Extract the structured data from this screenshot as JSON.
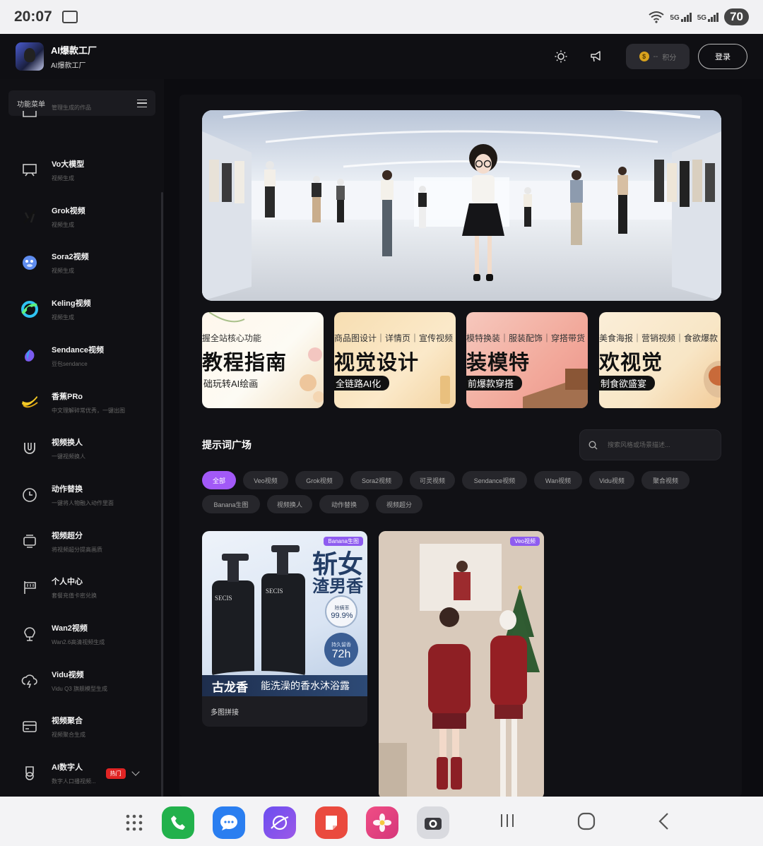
{
  "status": {
    "time": "20:07",
    "sig1": "5G",
    "sig2": "5G",
    "battery": "70"
  },
  "header": {
    "brand_title": "AI爆款工厂",
    "brand_sub": "AI爆款工厂",
    "points_value": "--",
    "points_unit": "积分",
    "login_label": "登录"
  },
  "sidebar": {
    "menu_title": "功能菜单",
    "items": [
      {
        "name": "",
        "desc": "管理生成的作品",
        "icon": "folder-icon"
      },
      {
        "name": "Vo大模型",
        "desc": "视频生成",
        "icon": "monitor-icon"
      },
      {
        "name": "Grok视频",
        "desc": "视频生成",
        "icon": "grok-logo-icon"
      },
      {
        "name": "Sora2视频",
        "desc": "视频生成",
        "icon": "sora-logo-icon"
      },
      {
        "name": "Keling视频",
        "desc": "视频生成",
        "icon": "keling-logo-icon"
      },
      {
        "name": "Sendance视频",
        "desc": "豆包sendance",
        "icon": "sendance-logo-icon"
      },
      {
        "name": "香蕉PRo",
        "desc": "中文理解碎常优秀，一键出图",
        "icon": "banana-icon"
      },
      {
        "name": "视频换人",
        "desc": "一键视频换人",
        "icon": "magnet-icon"
      },
      {
        "name": "动作替换",
        "desc": "一键将人物融入动作里面",
        "icon": "clock-icon"
      },
      {
        "name": "视频超分",
        "desc": "将视频超分提高画质",
        "icon": "upscale-icon"
      },
      {
        "name": "个人中心",
        "desc": "套餐充值卡密兑换",
        "icon": "flag-icon"
      },
      {
        "name": "Wan2视频",
        "desc": "Wan2.6高清视频生成",
        "icon": "wan-icon"
      },
      {
        "name": "Vidu视频",
        "desc": "Vidu Q3 旗舰模型生成",
        "icon": "cloud-bolt-icon"
      },
      {
        "name": "视频聚合",
        "desc": "视频聚合生成",
        "icon": "card-icon"
      },
      {
        "name": "AI数字人",
        "desc": "数字人口播视频...",
        "icon": "badge-icon",
        "badge": "热门"
      }
    ]
  },
  "banners": [
    {
      "small": "握全站核心功能",
      "big": "教程指南",
      "pill": "础玩转AI绘画"
    },
    {
      "small": "商品图设计｜详情页｜宣传视频",
      "big": "视觉设计",
      "pill": "全链路AI化"
    },
    {
      "small": "模特换装｜服装配饰｜穿搭带货",
      "big": "装模特",
      "pill": "前爆款穿搭"
    },
    {
      "small": "美食海报｜营销视频｜食欲爆款",
      "big": "欢视觉",
      "pill": "制食欲盛宴"
    }
  ],
  "prompts": {
    "title": "提示词广场",
    "search_placeholder": "搜索风格或场景描述...",
    "chips": [
      "全部",
      "Veo视频",
      "Grok视频",
      "Sora2视频",
      "可灵视频",
      "Sendance视频",
      "Wan视频",
      "Vidu视频",
      "聚合视频",
      "Banana生图",
      "视频换人",
      "动作替换",
      "视频超分"
    ],
    "active_chip": "全部"
  },
  "results": [
    {
      "tag": "Banana生图",
      "caption": "多图拼接",
      "headline1": "斩女",
      "headline2": "渣男香",
      "mite_label": "除螨率",
      "mite_value": "99.9%",
      "hours_label": "持久留香",
      "hours_value": "72h",
      "footer_left": "古龙香",
      "footer_right": "能洗澡的香水沐浴露",
      "bottle_brand": "SECIS"
    },
    {
      "tag": "Veo视频",
      "caption": ""
    }
  ],
  "colors": {
    "accent": "#a259f7",
    "hot_badge": "#e02424",
    "tag": "#8e5cf0"
  }
}
